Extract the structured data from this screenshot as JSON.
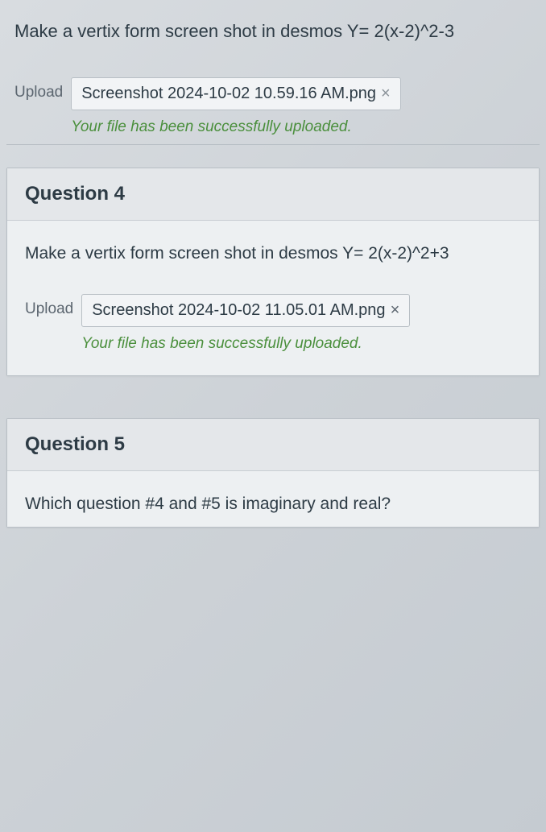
{
  "q3": {
    "prompt": "Make a vertix form screen shot in desmos Y= 2(x-2)^2-3",
    "upload_label": "Upload",
    "filename": "Screenshot 2024-10-02 10.59.16 AM.png",
    "remove_symbol": "×",
    "success_msg": "Your file has been successfully uploaded."
  },
  "q4": {
    "title": "Question 4",
    "prompt": "Make a vertix form screen shot in desmos Y= 2(x-2)^2+3",
    "upload_label": "Upload",
    "filename": "Screenshot 2024-10-02 11.05.01 AM.png",
    "remove_symbol": "×",
    "success_msg": "Your file has been successfully uploaded."
  },
  "q5": {
    "title": "Question 5",
    "prompt": "Which question #4 and #5 is imaginary and real?"
  }
}
